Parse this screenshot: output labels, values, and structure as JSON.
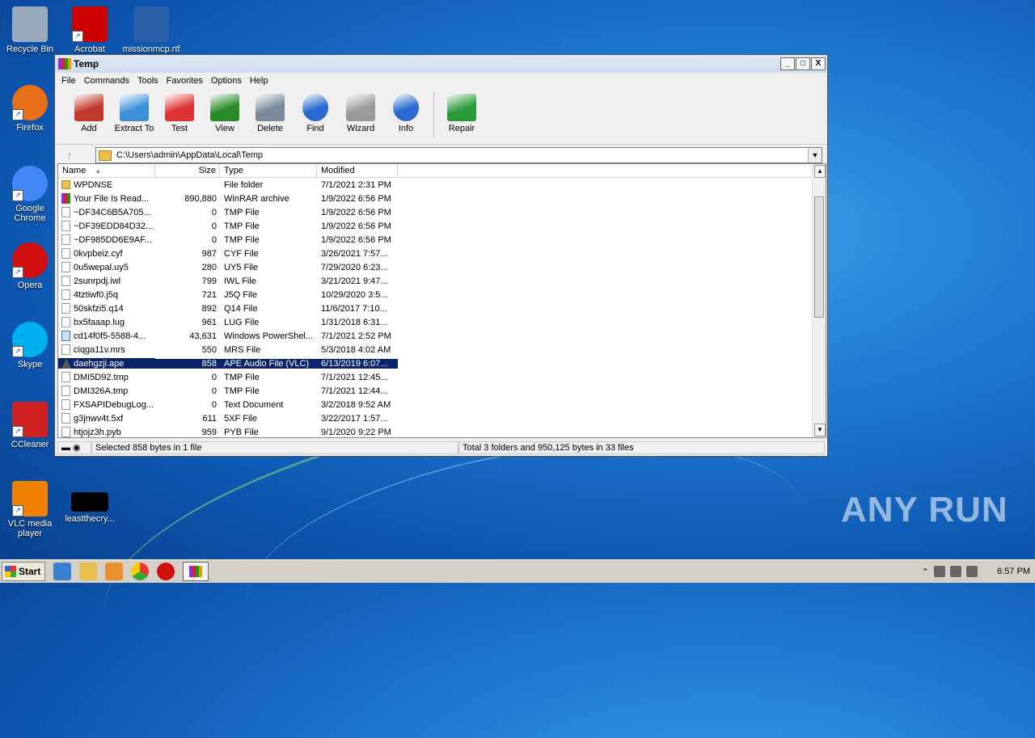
{
  "desktop": {
    "icons": [
      {
        "label": "Recycle Bin",
        "icon": "recycle-bin-icon"
      },
      {
        "label": "Acrobat",
        "icon": "acrobat-icon"
      },
      {
        "label": "missionmcp.rtf",
        "icon": "word-document-icon"
      },
      {
        "label": "Firefox",
        "icon": "firefox-icon"
      },
      {
        "label": "Google Chrome",
        "icon": "chrome-icon"
      },
      {
        "label": "Opera",
        "icon": "opera-icon"
      },
      {
        "label": "Skype",
        "icon": "skype-icon"
      },
      {
        "label": "CCleaner",
        "icon": "ccleaner-icon"
      },
      {
        "label": "VLC media player",
        "icon": "vlc-icon"
      },
      {
        "label": "leastthecry...",
        "icon": "black-thumbnail-icon"
      }
    ],
    "watermark": "ANY RUN"
  },
  "window": {
    "title": "Temp",
    "controls": {
      "minimize": "_",
      "maximize": "□",
      "close": "X"
    },
    "menu": [
      "File",
      "Commands",
      "Tools",
      "Favorites",
      "Options",
      "Help"
    ],
    "toolbar": [
      {
        "label": "Add",
        "icon": "add-archive-icon",
        "color": "#c0392b"
      },
      {
        "label": "Extract To",
        "icon": "extract-folder-icon",
        "color": "#3d8fd8"
      },
      {
        "label": "Test",
        "icon": "test-checklist-icon",
        "color": "#d33"
      },
      {
        "label": "View",
        "icon": "view-book-icon",
        "color": "#2a8a2a"
      },
      {
        "label": "Delete",
        "icon": "trash-icon",
        "color": "#7a8a9a"
      },
      {
        "label": "Find",
        "icon": "magnifier-icon",
        "color": "#2a6ad0"
      },
      {
        "label": "Wizard",
        "icon": "wizard-wand-icon",
        "color": "#9a9a9a"
      },
      {
        "label": "Info",
        "icon": "info-icon",
        "color": "#2a6ad0"
      },
      {
        "label": "Repair",
        "icon": "repair-icon",
        "color": "#2a9a3a"
      }
    ],
    "address": {
      "path": "C:\\Users\\admin\\AppData\\Local\\Temp"
    },
    "columns": {
      "name": "Name",
      "size": "Size",
      "type": "Type",
      "modified": "Modified"
    },
    "files": [
      {
        "name": "WPDNSE",
        "size": "",
        "type": "File folder",
        "modified": "7/1/2021 2:31 PM",
        "icon": "folder"
      },
      {
        "name": "Your File Is Read...",
        "size": "890,880",
        "type": "WinRAR archive",
        "modified": "1/9/2022 6:56 PM",
        "icon": "rar"
      },
      {
        "name": "~DF34C6B5A705...",
        "size": "0",
        "type": "TMP File",
        "modified": "1/9/2022 6:56 PM",
        "icon": "file"
      },
      {
        "name": "~DF39EDD84D32...",
        "size": "0",
        "type": "TMP File",
        "modified": "1/9/2022 6:56 PM",
        "icon": "file"
      },
      {
        "name": "~DF985DD6E9AF...",
        "size": "0",
        "type": "TMP File",
        "modified": "1/9/2022 6:56 PM",
        "icon": "file"
      },
      {
        "name": "0kvpbeiz.cyf",
        "size": "987",
        "type": "CYF File",
        "modified": "3/26/2021 7:57...",
        "icon": "file"
      },
      {
        "name": "0u5wepal.uy5",
        "size": "280",
        "type": "UY5 File",
        "modified": "7/29/2020 6:23...",
        "icon": "file"
      },
      {
        "name": "2sunrpdj.iwl",
        "size": "799",
        "type": "IWL File",
        "modified": "3/21/2021 9:47...",
        "icon": "file"
      },
      {
        "name": "4tztiwf0.j5q",
        "size": "721",
        "type": "J5Q File",
        "modified": "10/29/2020 3:5...",
        "icon": "file"
      },
      {
        "name": "50skfzi5.q14",
        "size": "892",
        "type": "Q14 File",
        "modified": "11/6/2017 7:10...",
        "icon": "file"
      },
      {
        "name": "bx5faaap.lug",
        "size": "961",
        "type": "LUG File",
        "modified": "1/31/2018 6:31...",
        "icon": "file"
      },
      {
        "name": "cd14f0f5-5588-4...",
        "size": "43,631",
        "type": "Windows PowerShel...",
        "modified": "7/1/2021 2:52 PM",
        "icon": "ps"
      },
      {
        "name": "ciqga11v.mrs",
        "size": "550",
        "type": "MRS File",
        "modified": "5/3/2018 4:02 AM",
        "icon": "file"
      },
      {
        "name": "daehgzji.ape",
        "size": "858",
        "type": "APE Audio File (VLC)",
        "modified": "6/13/2019 6:07...",
        "icon": "vlc",
        "selected": true
      },
      {
        "name": "DMI5D92.tmp",
        "size": "0",
        "type": "TMP File",
        "modified": "7/1/2021 12:45...",
        "icon": "file"
      },
      {
        "name": "DMI326A.tmp",
        "size": "0",
        "type": "TMP File",
        "modified": "7/1/2021 12:44...",
        "icon": "file"
      },
      {
        "name": "FXSAPIDebugLog...",
        "size": "0",
        "type": "Text Document",
        "modified": "3/2/2018 9:52 AM",
        "icon": "file"
      },
      {
        "name": "g3jnwv4t.5xf",
        "size": "611",
        "type": "5XF File",
        "modified": "3/22/2017 1:57...",
        "icon": "file"
      },
      {
        "name": "htjojz3h.pyb",
        "size": "959",
        "type": "PYB File",
        "modified": "9/1/2020 9:22 PM",
        "icon": "file"
      }
    ],
    "status": {
      "left": "Selected 858 bytes in 1 file",
      "right": "Total 3 folders and 950,125 bytes in 33 files"
    }
  },
  "taskbar": {
    "start_label": "Start",
    "clock": "6:57 PM"
  }
}
